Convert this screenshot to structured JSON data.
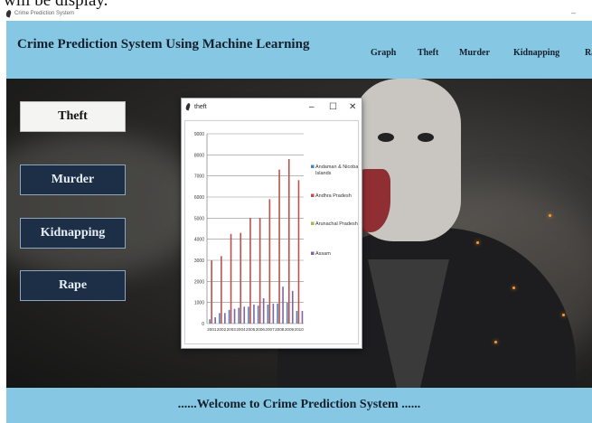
{
  "caption": "will be display.",
  "window": {
    "title": "Crime Prediction System",
    "minimize_glyph": "–"
  },
  "header": {
    "title": "Crime Prediction System Using Machine Learning",
    "nav": [
      "Graph",
      "Theft",
      "Murder",
      "Kidnapping",
      "Ra"
    ]
  },
  "sidebar": {
    "buttons": [
      "Theft",
      "Murder",
      "Kidnapping",
      "Rape"
    ],
    "active": "Theft"
  },
  "popup": {
    "title": "theft",
    "controls": {
      "minimize": "–",
      "maximize": "☐",
      "close": "✕"
    }
  },
  "footer": {
    "text": "......Welcome to Crime Prediction System ......"
  },
  "colors": {
    "header_bg": "#86c8e4",
    "button_bg": "#1c2f47",
    "andhra": "#c0504d",
    "andaman": "#4f81bd",
    "arunachal": "#9bbb59",
    "assam": "#8064a2"
  },
  "chart_data": {
    "type": "bar",
    "categories": [
      "2001",
      "2002",
      "2003",
      "2004",
      "2005",
      "2006",
      "2007",
      "2008",
      "2009",
      "2010"
    ],
    "ylim": [
      0,
      9000
    ],
    "yticks": [
      0,
      1000,
      2000,
      3000,
      4000,
      5000,
      6000,
      7000,
      8000,
      9000
    ],
    "series": [
      {
        "name": "Andaman & Nicobar Islands",
        "color": "#4f81bd",
        "values": [
          200,
          500,
          650,
          750,
          800,
          850,
          900,
          950,
          1000,
          600
        ]
      },
      {
        "name": "Andhra Pradesh",
        "color": "#c0504d",
        "values": [
          3000,
          3200,
          4250,
          4300,
          5000,
          5000,
          5900,
          7300,
          7800,
          6800
        ]
      },
      {
        "name": "Arunachal Pradesh",
        "color": "#9bbb59",
        "values": [
          20,
          20,
          25,
          25,
          25,
          30,
          30,
          35,
          35,
          30
        ]
      },
      {
        "name": "Assam",
        "color": "#8064a2",
        "values": [
          300,
          500,
          700,
          800,
          900,
          1200,
          950,
          1750,
          1550,
          600
        ]
      }
    ]
  }
}
